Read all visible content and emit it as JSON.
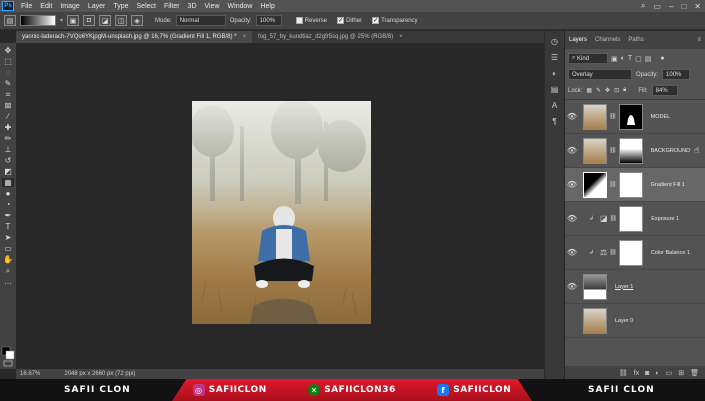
{
  "menubar": {
    "logo": "Ps",
    "items": [
      "File",
      "Edit",
      "Image",
      "Layer",
      "Type",
      "Select",
      "Filter",
      "3D",
      "View",
      "Window",
      "Help"
    ]
  },
  "options": {
    "mode_label": "Mode:",
    "mode_value": "Normal",
    "opacity_label": "Opacity:",
    "opacity_value": "100%",
    "reverse_label": "Reverse",
    "dither_label": "Dither",
    "transparency_label": "Transparency"
  },
  "tabs": [
    {
      "label": "yannic-laderach-7VQo6YKjpgM-unsplash.jpg @ 16,7% (Gradient Fill 1, RGB/8) *",
      "close": "×"
    },
    {
      "label": "fog_57_by_kundtiaz_d2gfr5sq.jpg @ 25% (RGB/8)",
      "close": "×"
    }
  ],
  "statusbar": {
    "zoom": "16.67%",
    "doc_info": "2048 px x 2660 px (72 ppi)"
  },
  "panel": {
    "tabs": [
      "Layers",
      "Channels",
      "Paths"
    ],
    "kind_label": "Kind",
    "blend_mode": "Overlay",
    "opacity_label": "Opacity:",
    "opacity_value": "100%",
    "lock_label": "Lock:",
    "fill_label": "Fill:",
    "fill_value": "84%",
    "layers": [
      {
        "name": "MODEL"
      },
      {
        "name": "BACKGROUND"
      },
      {
        "name": "Gradient Fill 1"
      },
      {
        "name": "Exposure 1"
      },
      {
        "name": "Color Balance 1"
      },
      {
        "name": "Layer 1"
      },
      {
        "name": "Layer 0"
      }
    ]
  },
  "banner": {
    "left_name": "SAFII CLON",
    "instagram": "SAFIICLON",
    "xbox": "SAFIICLON36",
    "facebook": "SAFIICLON",
    "right_name": "SAFII CLON"
  },
  "colors": {
    "accent": "#31a8ff",
    "banner_red": "#e0192b",
    "instagram": "#c13584",
    "xbox": "#107c10",
    "facebook": "#1877f2"
  }
}
